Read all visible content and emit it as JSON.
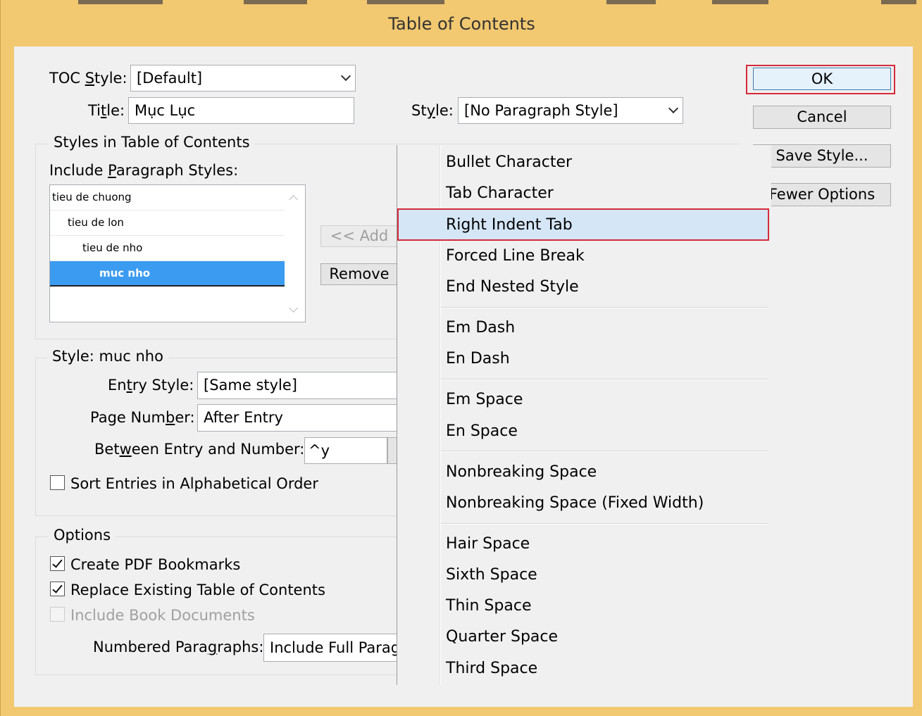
{
  "window": {
    "title": "Table of Contents"
  },
  "toc_style": {
    "label": "TOC Style:",
    "value": "[Default]"
  },
  "title_field": {
    "label": "Title:",
    "value": "Mục Lục"
  },
  "style_field": {
    "label": "Style:",
    "value": "[No Paragraph Style]"
  },
  "buttons": {
    "ok": "OK",
    "cancel": "Cancel",
    "save_style": "Save Style...",
    "fewer_options": "Fewer Options",
    "add": "<< Add",
    "remove": "Remove"
  },
  "styles_group": {
    "title": "Styles in Table of Contents",
    "include_label": "Include Paragraph Styles:",
    "items": [
      {
        "label": "tieu de chuong",
        "selected": false
      },
      {
        "label": "tieu de lon",
        "selected": false
      },
      {
        "label": "tieu de nho",
        "selected": false
      },
      {
        "label": "muc nho",
        "selected": true
      }
    ]
  },
  "style_group": {
    "title": "Style: muc nho",
    "entry_style_label": "Entry Style:",
    "entry_style_value": "[Same style]",
    "page_number_label": "Page Number:",
    "page_number_value": "After Entry",
    "between_label": "Between Entry and Number:",
    "between_value": "^y",
    "sort_label": "Sort Entries in Alphabetical Order",
    "sort_checked": false
  },
  "options_group": {
    "title": "Options",
    "pdf_bookmarks": {
      "label": "Create PDF Bookmarks",
      "checked": true
    },
    "replace_existing": {
      "label": "Replace Existing Table of Contents",
      "checked": true
    },
    "include_book": {
      "label": "Include Book Documents",
      "checked": false,
      "disabled": true
    },
    "numbered_label": "Numbered Paragraphs:",
    "numbered_value": "Include Full Paragraph"
  },
  "special_char_menu": {
    "groups": [
      [
        "Bullet Character",
        "Tab Character",
        "Right Indent Tab",
        "Forced Line Break",
        "End Nested Style"
      ],
      [
        "Em Dash",
        "En Dash"
      ],
      [
        "Em Space",
        "En Space"
      ],
      [
        "Nonbreaking Space",
        "Nonbreaking Space (Fixed Width)"
      ],
      [
        "Hair Space",
        "Sixth Space",
        "Thin Space",
        "Quarter Space",
        "Third Space"
      ]
    ],
    "highlighted": "Right Indent Tab"
  },
  "colors": {
    "title_bar": "#f2c870",
    "highlight_border": "#d42b3a",
    "selection": "#3b9bf0",
    "menu_hover": "#d5e6f7"
  }
}
